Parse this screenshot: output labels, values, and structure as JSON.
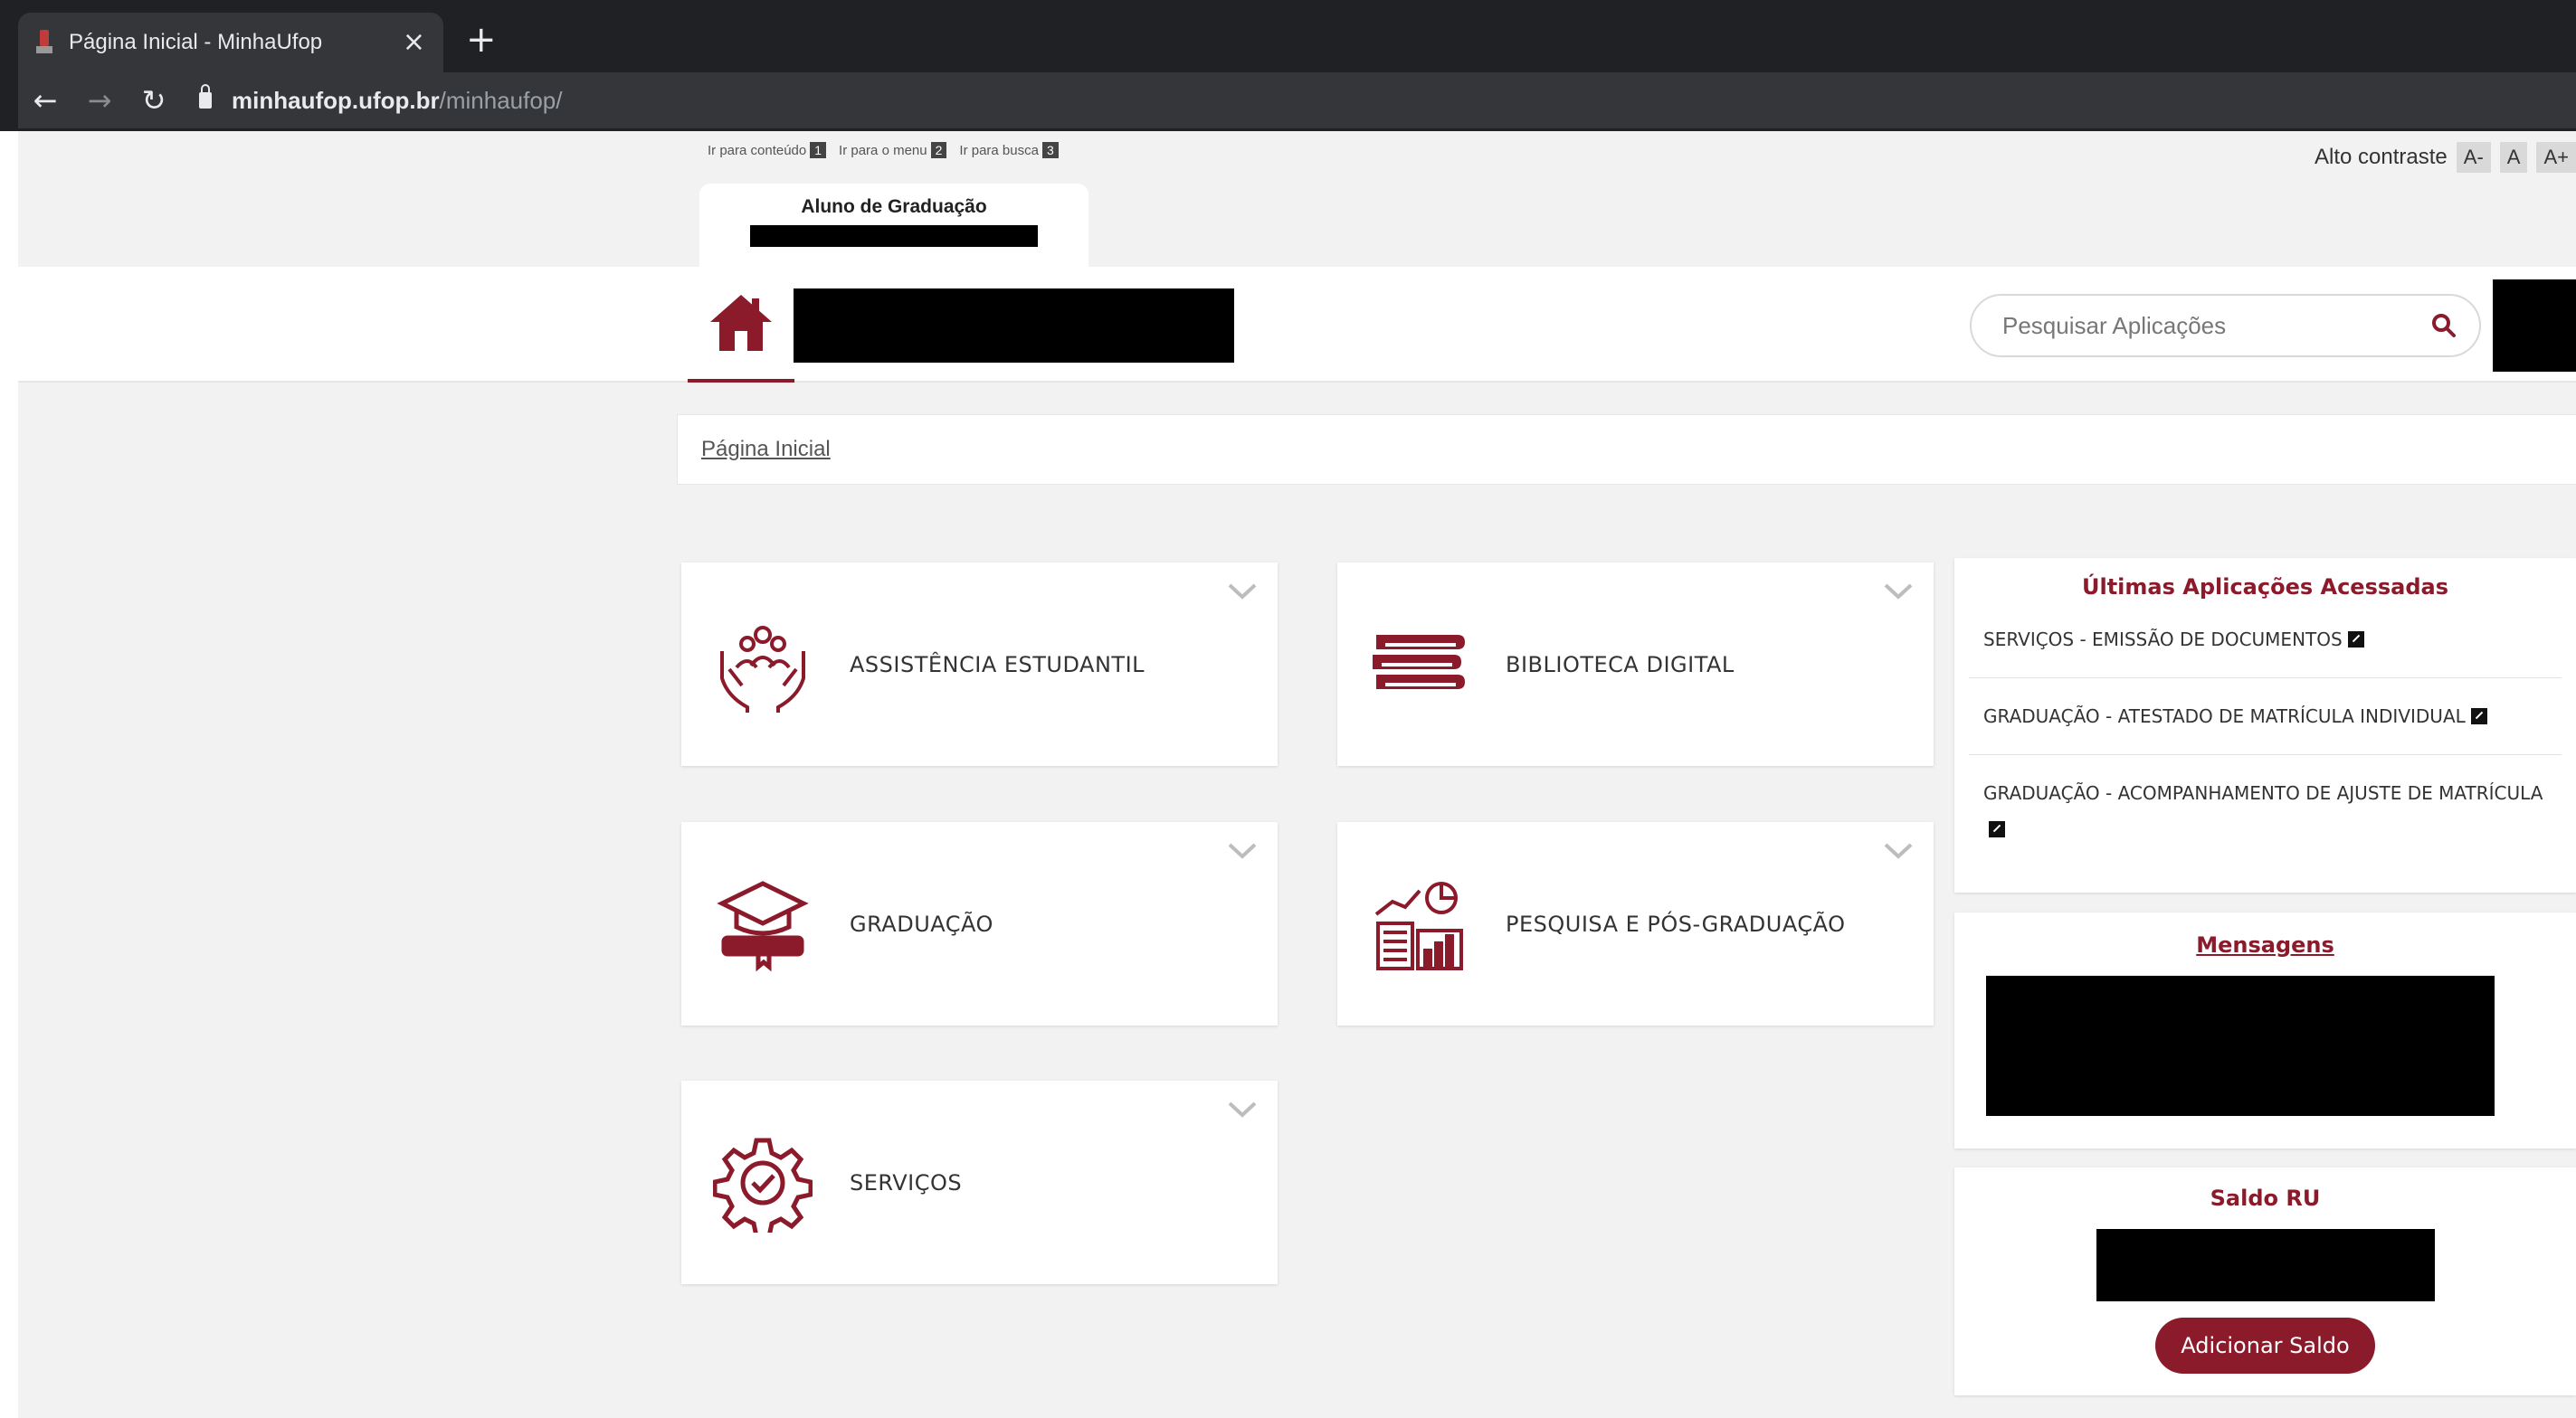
{
  "browser": {
    "tab_title": "Página Inicial - MinhaUfop",
    "tab_close": "×",
    "new_tab": "+",
    "url_host": "minhaufop.ufop.br",
    "url_path": "/minhaufop/"
  },
  "skip_links": [
    {
      "label": "Ir para conteúdo",
      "key": "1"
    },
    {
      "label": "Ir para o menu",
      "key": "2"
    },
    {
      "label": "Ir para busca",
      "key": "3"
    }
  ],
  "accessibility": {
    "contrast_label": "Alto contraste",
    "font_decrease": "A-",
    "font_reset": "A",
    "font_increase": "A+"
  },
  "user": {
    "role": "Aluno de Graduação"
  },
  "search": {
    "placeholder": "Pesquisar Aplicações"
  },
  "breadcrumb": {
    "home": "Página Inicial"
  },
  "cards": [
    {
      "label": "ASSISTÊNCIA ESTUDANTIL",
      "icon": "hands-people-icon"
    },
    {
      "label": "BIBLIOTECA DIGITAL",
      "icon": "books-icon"
    },
    {
      "label": "GRADUAÇÃO",
      "icon": "graduation-cap-icon"
    },
    {
      "label": "PESQUISA E PÓS-GRADUAÇÃO",
      "icon": "research-chart-icon"
    },
    {
      "label": "SERVIÇOS",
      "icon": "gear-check-icon"
    }
  ],
  "recent": {
    "title": "Últimas Aplicações Acessadas",
    "items": [
      "SERVIÇOS - EMISSÃO DE DOCUMENTOS",
      "GRADUAÇÃO - ATESTADO DE MATRÍCULA INDIVIDUAL",
      "GRADUAÇÃO - ACOMPANHAMENTO DE AJUSTE DE MATRÍCULA"
    ]
  },
  "messages": {
    "title": "Mensagens"
  },
  "balance": {
    "title": "Saldo RU",
    "add_button": "Adicionar Saldo"
  },
  "colors": {
    "brand": "#8b1a2b",
    "chrome": "#202124",
    "background": "#f2f2f2"
  }
}
